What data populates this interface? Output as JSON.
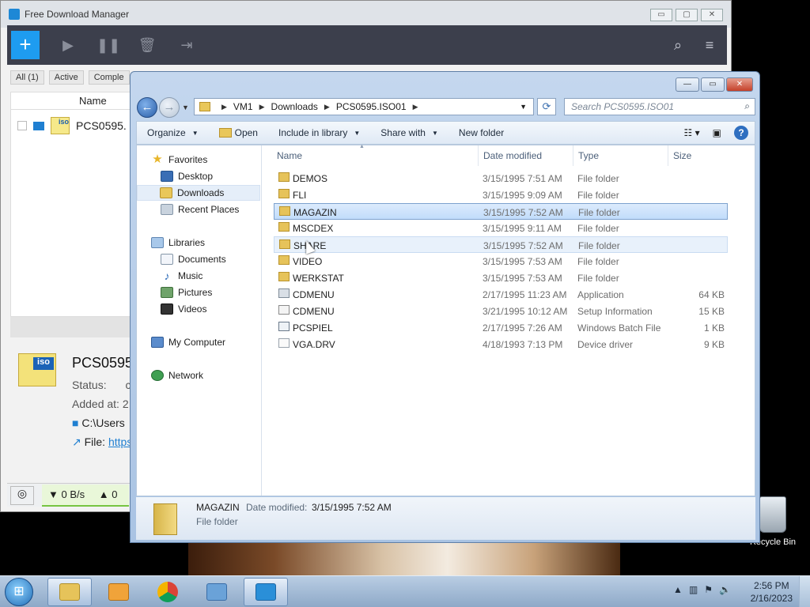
{
  "fdm": {
    "title": "Free Download Manager",
    "caption": {
      "min": "▭",
      "max": "▢",
      "close": "✕"
    },
    "tabs": [
      "All (1)",
      "Active",
      "Comple"
    ],
    "list_header": "Name",
    "item_name": "PCS0595.",
    "detail": {
      "title": "PCS0595",
      "status_label": "Status:",
      "status_value": "c",
      "added_label": "Added at:",
      "added_value": "2",
      "path": "C:\\Users",
      "file_label": "File:",
      "file_link": "https:"
    },
    "status": {
      "down_speed": "▼ 0 B/s",
      "up_speed": "▲ 0"
    }
  },
  "explorer": {
    "breadcrumb": [
      "VM1",
      "Downloads",
      "PCS0595.ISO01"
    ],
    "search_placeholder": "Search PCS0595.ISO01",
    "commands": {
      "organize": "Organize",
      "open": "Open",
      "include": "Include in library",
      "share": "Share with",
      "new_folder": "New folder"
    },
    "nav": {
      "favorites": "Favorites",
      "desktop": "Desktop",
      "downloads": "Downloads",
      "recent": "Recent Places",
      "libraries": "Libraries",
      "documents": "Documents",
      "music": "Music",
      "pictures": "Pictures",
      "videos": "Videos",
      "computer": "My Computer",
      "network": "Network"
    },
    "columns": {
      "name": "Name",
      "date": "Date modified",
      "type": "Type",
      "size": "Size"
    },
    "files": [
      {
        "name": "DEMOS",
        "date": "3/15/1995 7:51 AM",
        "type": "File folder",
        "size": "",
        "icon": "folder"
      },
      {
        "name": "FLI",
        "date": "3/15/1995 9:09 AM",
        "type": "File folder",
        "size": "",
        "icon": "folder"
      },
      {
        "name": "MAGAZIN",
        "date": "3/15/1995 7:52 AM",
        "type": "File folder",
        "size": "",
        "icon": "folder"
      },
      {
        "name": "MSCDEX",
        "date": "3/15/1995 9:11 AM",
        "type": "File folder",
        "size": "",
        "icon": "folder"
      },
      {
        "name": "SHARE",
        "date": "3/15/1995 7:52 AM",
        "type": "File folder",
        "size": "",
        "icon": "folder"
      },
      {
        "name": "VIDEO",
        "date": "3/15/1995 7:53 AM",
        "type": "File folder",
        "size": "",
        "icon": "folder"
      },
      {
        "name": "WERKSTAT",
        "date": "3/15/1995 7:53 AM",
        "type": "File folder",
        "size": "",
        "icon": "folder"
      },
      {
        "name": "CDMENU",
        "date": "2/17/1995 11:23 AM",
        "type": "Application",
        "size": "64 KB",
        "icon": "application"
      },
      {
        "name": "CDMENU",
        "date": "3/21/1995 10:12 AM",
        "type": "Setup Information",
        "size": "15 KB",
        "icon": "setup-information"
      },
      {
        "name": "PCSPIEL",
        "date": "2/17/1995 7:26 AM",
        "type": "Windows Batch File",
        "size": "1 KB",
        "icon": "batch-file"
      },
      {
        "name": "VGA.DRV",
        "date": "4/18/1993 7:13 PM",
        "type": "Device driver",
        "size": "9 KB",
        "icon": "driver"
      }
    ],
    "selected": {
      "name": "MAGAZIN",
      "date_label": "Date modified:",
      "date_value": "3/15/1995 7:52 AM",
      "type": "File folder"
    }
  },
  "desktop": {
    "recycle_bin": "Recycle Bin"
  },
  "taskbar": {
    "time": "2:56 PM",
    "date": "2/16/2023"
  }
}
